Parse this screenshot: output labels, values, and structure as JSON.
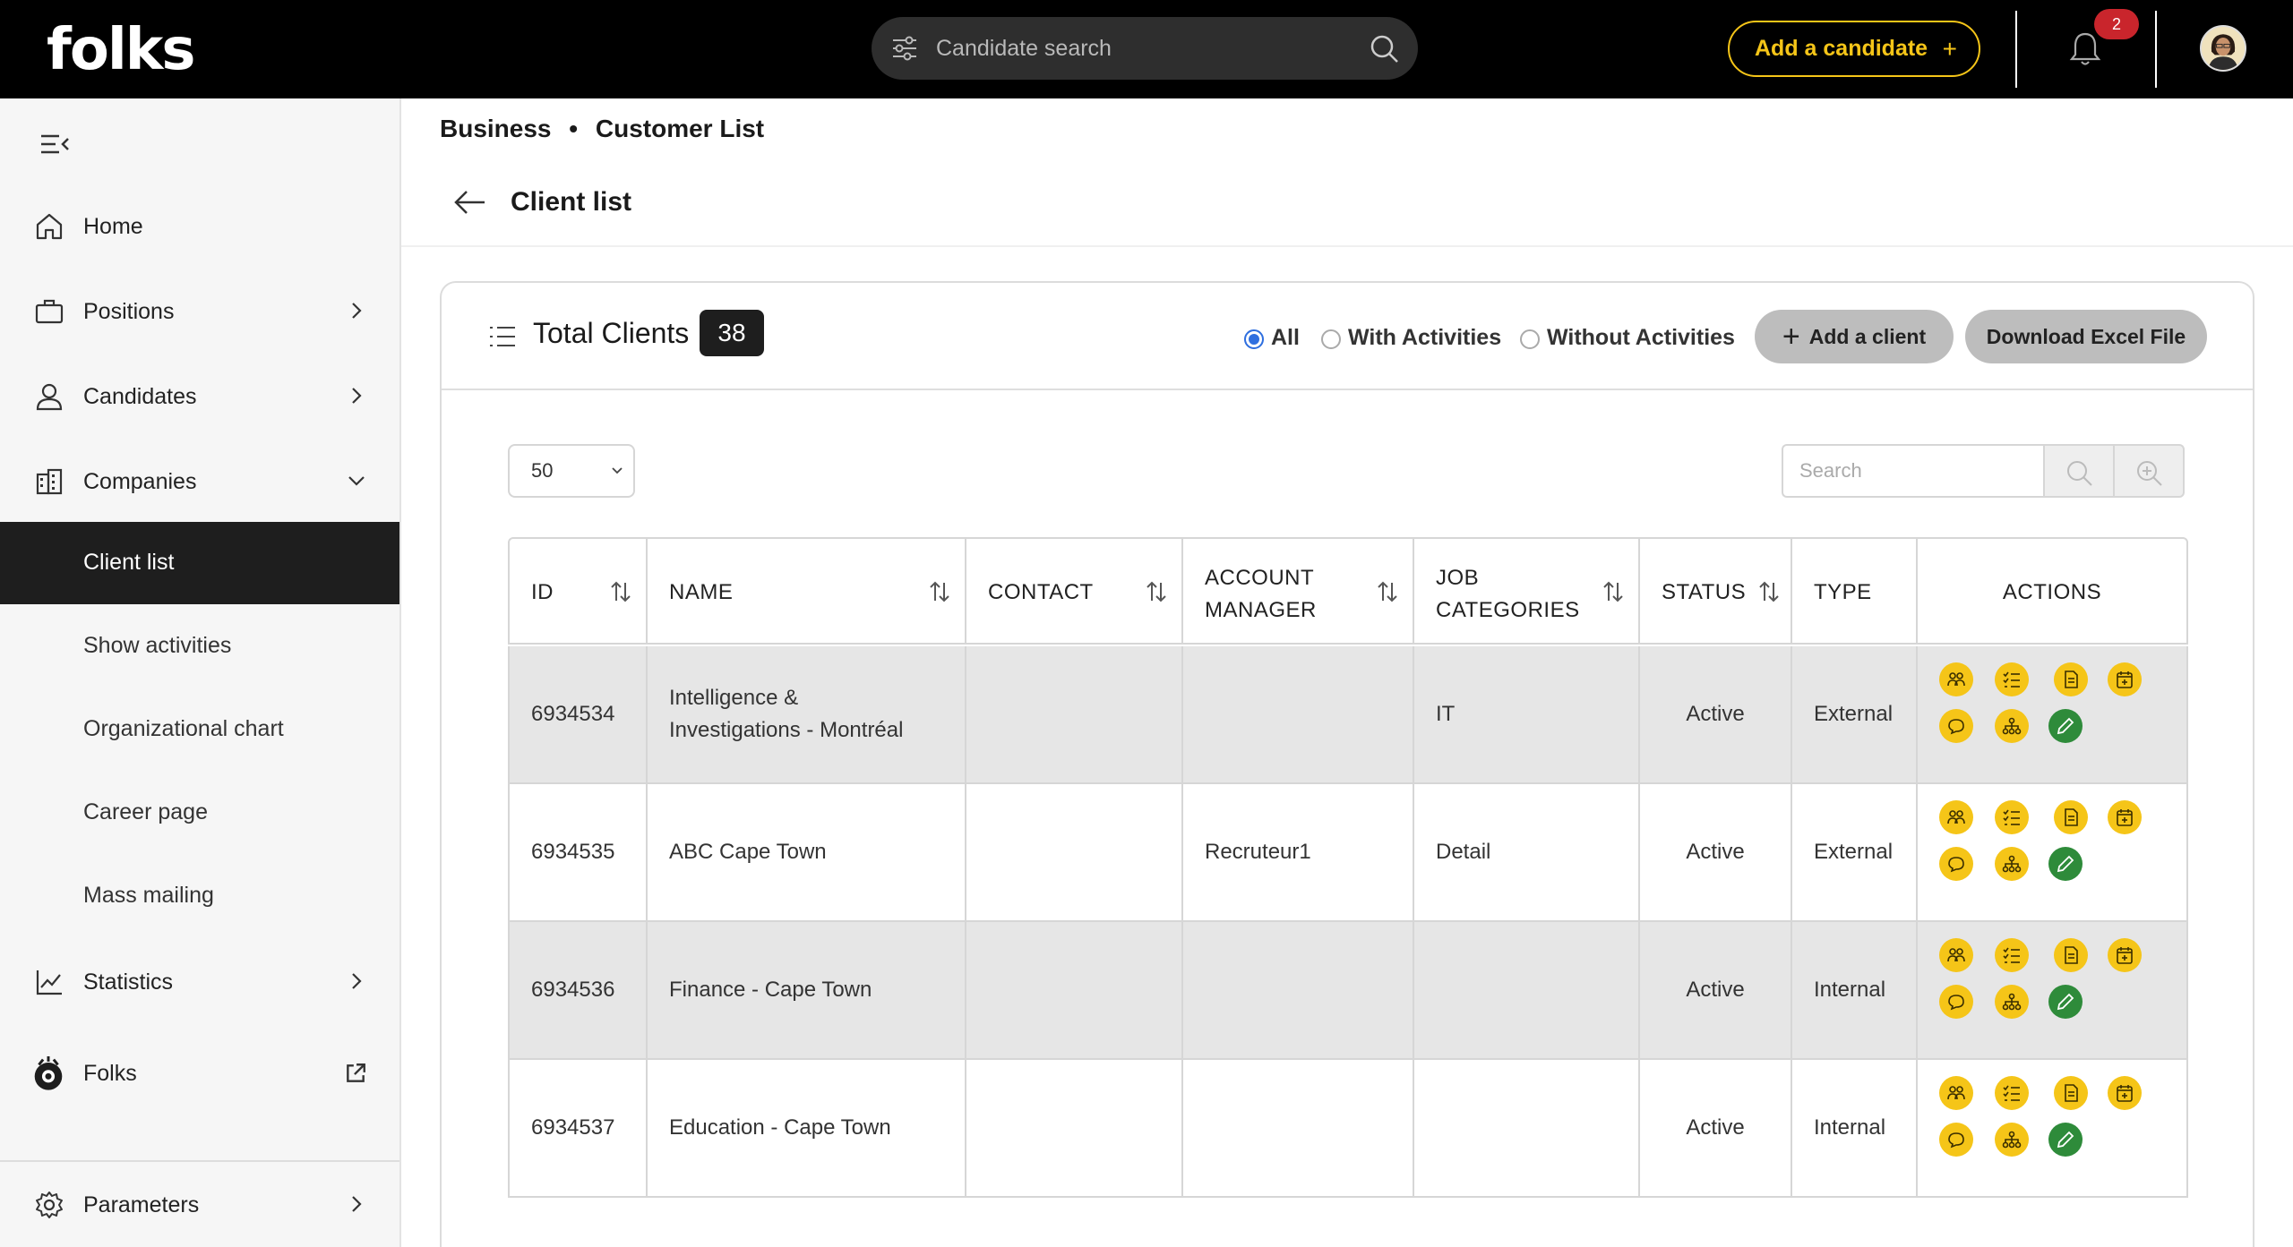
{
  "topbar": {
    "logo": "folks",
    "search_placeholder": "Candidate search",
    "add_candidate_label": "Add a candidate",
    "add_candidate_plus": "+",
    "notification_count": "2"
  },
  "sidebar": {
    "items": [
      {
        "label": "Home",
        "icon": "home-icon"
      },
      {
        "label": "Positions",
        "icon": "briefcase-icon"
      },
      {
        "label": "Candidates",
        "icon": "user-icon"
      },
      {
        "label": "Companies",
        "icon": "building-icon"
      }
    ],
    "sub_items": [
      {
        "label": "Client list",
        "active": true
      },
      {
        "label": "Show activities"
      },
      {
        "label": "Organizational chart"
      },
      {
        "label": "Career page"
      },
      {
        "label": "Mass mailing"
      }
    ],
    "statistics_label": "Statistics",
    "folks_label": "Folks",
    "parameters_label": "Parameters"
  },
  "breadcrumb": {
    "part1": "Business",
    "separator": "•",
    "part2": "Customer List"
  },
  "page_title": "Client list",
  "panel": {
    "total_label": "Total Clients",
    "total_count": "38",
    "filters": [
      {
        "label": "All",
        "selected": true
      },
      {
        "label": "With Activities",
        "selected": false
      },
      {
        "label": "Without Activities",
        "selected": false
      }
    ],
    "add_client_label": "Add a client",
    "add_client_plus": "+",
    "download_label": "Download Excel File",
    "page_size": "50",
    "search_placeholder": "Search"
  },
  "table": {
    "headers": {
      "id": "ID",
      "name": "NAME",
      "contact": "CONTACT",
      "account_manager_1": "ACCOUNT",
      "account_manager_2": "MANAGER",
      "job_categories_1": "JOB",
      "job_categories_2": "CATEGORIES",
      "status": "STATUS",
      "type": "TYPE",
      "actions": "ACTIONS"
    },
    "rows": [
      {
        "id": "6934534",
        "name_1": "Intelligence &",
        "name_2": "Investigations - Montréal",
        "contact": "",
        "account_manager": "",
        "job_categories": "IT",
        "status": "Active",
        "type": "External"
      },
      {
        "id": "6934535",
        "name_1": "ABC Cape Town",
        "name_2": "",
        "contact": "",
        "account_manager": "Recruteur1",
        "job_categories": "Detail",
        "status": "Active",
        "type": "External"
      },
      {
        "id": "6934536",
        "name_1": "Finance - Cape Town",
        "name_2": "",
        "contact": "",
        "account_manager": "",
        "job_categories": "",
        "status": "Active",
        "type": "Internal"
      },
      {
        "id": "6934537",
        "name_1": "Education - Cape Town",
        "name_2": "",
        "contact": "",
        "account_manager": "",
        "job_categories": "",
        "status": "Active",
        "type": "Internal"
      }
    ],
    "action_icons": [
      "people-icon",
      "checklist-icon",
      "document-icon",
      "calendar-add-icon",
      "comment-icon",
      "org-chart-icon",
      "edit-icon"
    ]
  },
  "colors": {
    "accent": "#f5c518",
    "topbar": "#000000",
    "active_nav": "#1e1e1e",
    "edit_green": "#2e8b3a",
    "radio_blue": "#2f6fdf",
    "badge_red": "#c9252c"
  }
}
